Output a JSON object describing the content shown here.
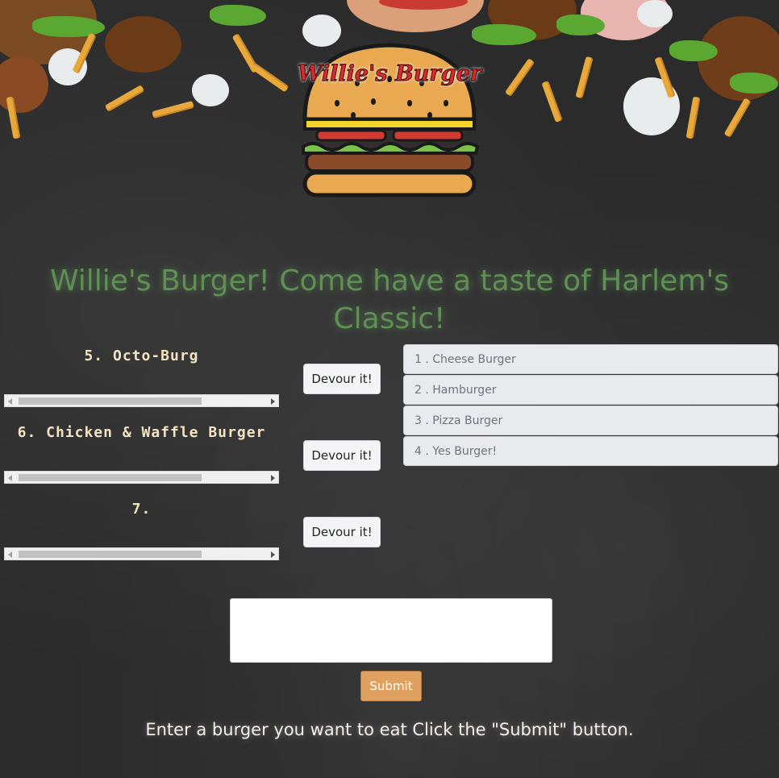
{
  "logo": {
    "text": "Willie's Burger",
    "icon": "burger-icon"
  },
  "headline": "Willie's Burger! Come have a taste of Harlem's Classic!",
  "uneaten_burgers": [
    {
      "label": "5. Octo-Burg",
      "button_label": "Devour it!"
    },
    {
      "label": "6. Chicken & Waffle Burger",
      "button_label": "Devour it!"
    },
    {
      "label": "7.",
      "button_label": "Devour it!"
    }
  ],
  "eaten_burgers": [
    "1 . Cheese Burger",
    "2 . Hamburger",
    "3 . Pizza Burger",
    "4 . Yes Burger!"
  ],
  "form": {
    "input_value": "",
    "submit_label": "Submit"
  },
  "instructions": "Enter a burger you want to eat Click the \"Submit\" button.",
  "colors": {
    "background": "#2b2b2b",
    "headline": "#5f8f52",
    "burger_name": "#f3e3c2",
    "submit_button": "#e0a060",
    "logo_text": "#d72c2c"
  }
}
